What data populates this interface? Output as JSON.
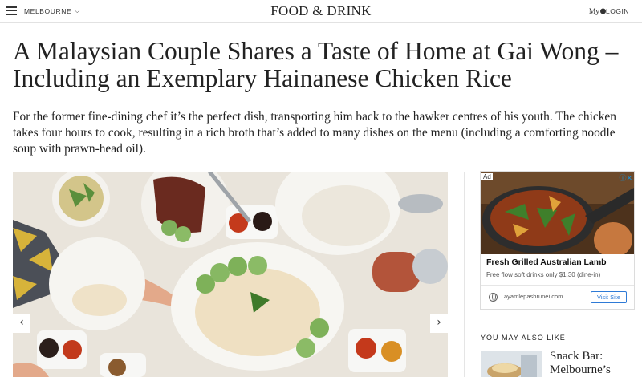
{
  "header": {
    "city": "MELBOURNE",
    "logo": "FOOD & DRINK",
    "login_my": "My",
    "login_label": "LOGIN"
  },
  "article": {
    "headline": "A Malaysian Couple Shares a Taste of Home at Gai Wong – Including an Exemplary Hainanese Chicken Rice",
    "standfirst": "For the former fine-dining chef it’s the perfect dish, transporting him back to the hawker centres of his youth. The chicken takes four hours to cook, resulting in a rich broth that’s added to many dishes on the menu (including a comforting noodle soup with prawn-head oil).",
    "carousel_prev": "‹",
    "carousel_next": "›"
  },
  "ad": {
    "tag": "Ad",
    "choices": "ⓘ✕",
    "title": "Fresh Grilled Australian Lamb",
    "subtitle": "Free flow soft drinks only $1.30 (dine-in)",
    "domain": "ayamlepasbrunei.com",
    "cta": "Visit Site"
  },
  "sidebar": {
    "section_title": "YOU MAY ALSO LIKE",
    "items": [
      {
        "title": "Snack Bar: Melbourne’s"
      }
    ]
  },
  "icons": {
    "menu": "hamburger-icon",
    "city_dropdown": "chevron-down-icon",
    "prev": "chevron-left-icon",
    "next": "chevron-right-icon",
    "ad_info": "info-close-icon",
    "ad_domain": "globe-icon"
  },
  "colors": {
    "text": "#222222",
    "ad_cta": "#2e7ad6",
    "ad_choices": "#1a8fd1",
    "divider": "#e2e2e2"
  }
}
